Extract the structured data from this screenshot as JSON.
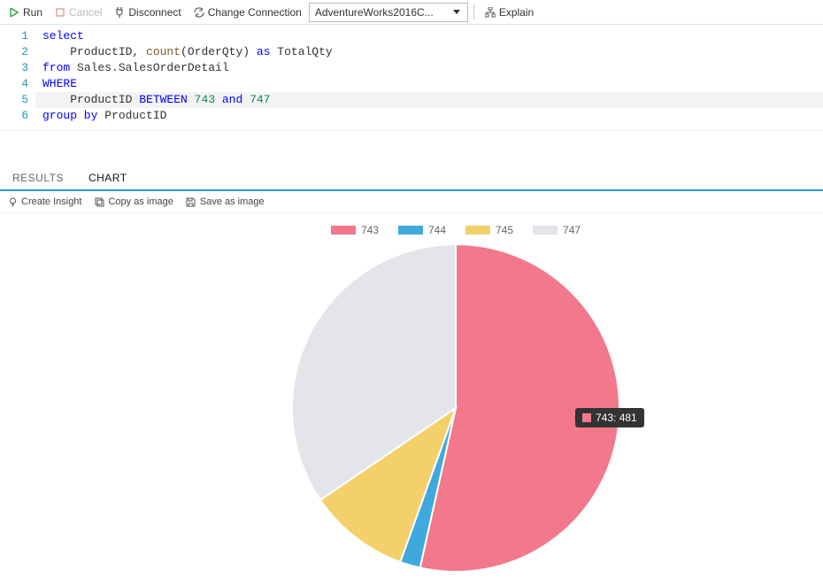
{
  "toolbar": {
    "run": "Run",
    "cancel": "Cancel",
    "disconnect": "Disconnect",
    "change_connection": "Change Connection",
    "explain": "Explain",
    "database": "AdventureWorks2016C..."
  },
  "editor": {
    "lines": [
      "1",
      "2",
      "3",
      "4",
      "5",
      "6"
    ],
    "code": {
      "l1": {
        "a": "select"
      },
      "l2": {
        "a": "    ProductID, ",
        "b": "count",
        "c": "(OrderQty) ",
        "d": "as",
        "e": " TotalQty"
      },
      "l3": {
        "a": "from",
        "b": " Sales.SalesOrderDetail"
      },
      "l4": {
        "a": "WHERE"
      },
      "l5": {
        "a": "    ProductID ",
        "b": "BETWEEN",
        "c": " ",
        "d": "743",
        "e": " ",
        "f": "and",
        "g": " ",
        "h": "747"
      },
      "l6": {
        "a": "group by",
        "b": " ProductID"
      }
    }
  },
  "tabs": {
    "results": "RESULTS",
    "chart": "CHART"
  },
  "sub": {
    "insight": "Create Insight",
    "copy": "Copy as image",
    "save": "Save as image"
  },
  "legend": {
    "a": "743",
    "b": "744",
    "c": "745",
    "d": "747"
  },
  "tooltip": "743: 481",
  "colors": {
    "pink": "#f2788b",
    "blue": "#3fa9de",
    "yellow": "#f4d06b",
    "grey": "#e4e5ea"
  },
  "chart_data": {
    "type": "pie",
    "title": "",
    "categories": [
      "743",
      "744",
      "745",
      "747"
    ],
    "values": [
      481,
      18,
      90,
      310
    ],
    "tooltip": {
      "category": "743",
      "value": 481
    },
    "legend_position": "top"
  }
}
